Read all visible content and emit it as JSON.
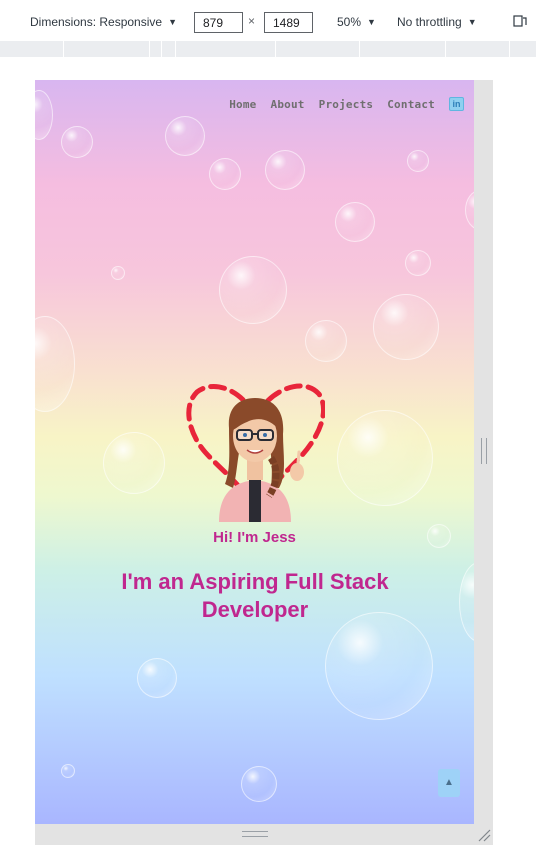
{
  "toolbar": {
    "dimensions_label": "Dimensions: Responsive",
    "width_value": "879",
    "times_sign": "×",
    "height_value": "1489",
    "zoom": "50%",
    "throttling": "No throttling"
  },
  "nav": {
    "items": [
      "Home",
      "About",
      "Projects",
      "Contact"
    ],
    "linkedin_glyph": "in"
  },
  "hero": {
    "greeting": "Hi! I'm Jess",
    "headline": "I'm an Aspiring Full Stack Developer"
  },
  "scroll_top_glyph": "▲",
  "colors": {
    "accent": "#c0278f",
    "heart": "#e8253a",
    "nav_text": "#6f6f6f"
  }
}
